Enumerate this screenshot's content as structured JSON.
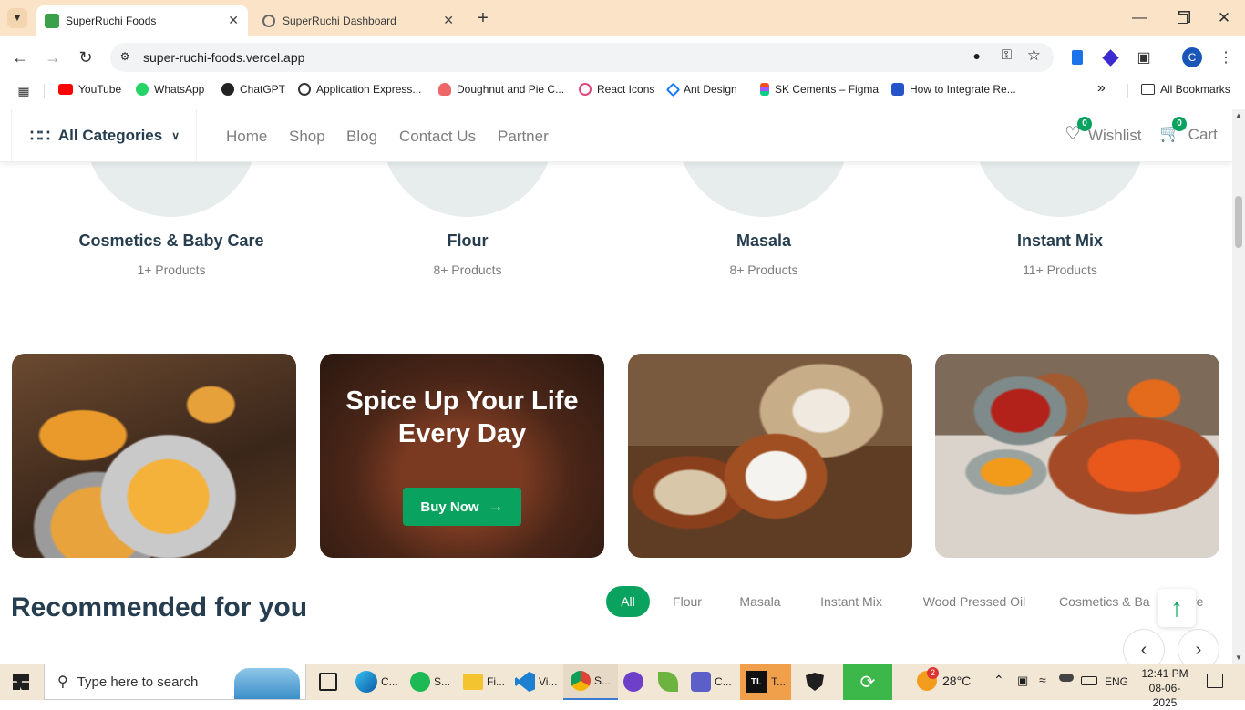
{
  "browser": {
    "tabs": [
      {
        "title": "SuperRuchi Foods",
        "active": true
      },
      {
        "title": "SuperRuchi Dashboard",
        "active": false
      }
    ],
    "url": "super-ruchi-foods.vercel.app",
    "profile_initial": "C",
    "bookmarks": [
      "YouTube",
      "WhatsApp",
      "ChatGPT",
      "Application Express...",
      "Doughnut and Pie C...",
      "React Icons",
      "Ant Design",
      "SK Cements – Figma",
      "How to Integrate Re..."
    ],
    "bookmarks_more": "»",
    "all_bookmarks": "All Bookmarks"
  },
  "site": {
    "all_categories": "All Categories",
    "nav": [
      "Home",
      "Shop",
      "Blog",
      "Contact Us",
      "Partner"
    ],
    "wishlist": {
      "label": "Wishlist",
      "count": "0"
    },
    "cart": {
      "label": "Cart",
      "count": "0"
    },
    "categories": [
      {
        "name": "Cosmetics & Baby Care",
        "count": "1+ Products"
      },
      {
        "name": "Flour",
        "count": "8+ Products"
      },
      {
        "name": "Masala",
        "count": "8+ Products"
      },
      {
        "name": "Instant Mix",
        "count": "11+ Products"
      }
    ],
    "promo": {
      "title_line1": "Spice Up Your Life",
      "title_line2": "Every Day",
      "button": "Buy Now"
    },
    "recommended_title": "Recommended for you",
    "filters": [
      "All",
      "Flour",
      "Masala",
      "Instant Mix",
      "Wood Pressed Oil",
      "Cosmetics & Ba",
      "re"
    ],
    "accent": "#0aa25f"
  },
  "taskbar": {
    "search_placeholder": "Type here to search",
    "apps": [
      "C...",
      "S...",
      "Fi...",
      "Vi...",
      "S...",
      "",
      "",
      "C...",
      "T..."
    ],
    "weather": "28°C",
    "weather_badge": "2",
    "language": "ENG",
    "time": "12:41 PM",
    "date": "08-06-2025"
  }
}
